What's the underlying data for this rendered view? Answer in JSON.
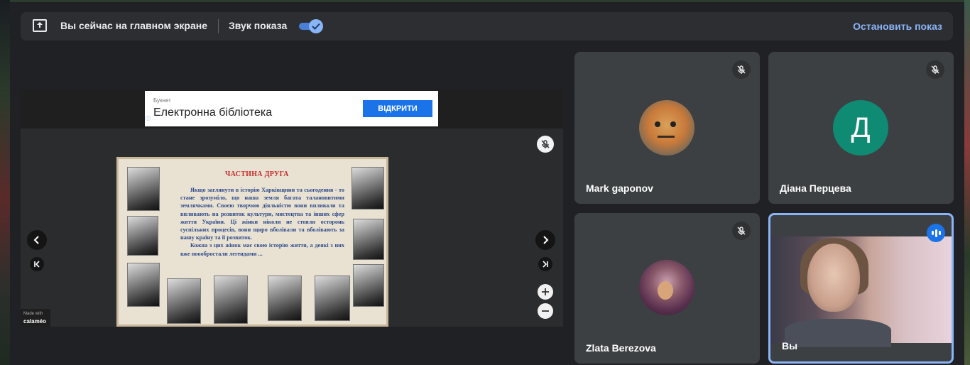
{
  "banner": {
    "status_text": "Вы сейчас на главном экране",
    "sound_label": "Звук показа",
    "sound_enabled": true,
    "stop_label": "Остановить показ"
  },
  "ad": {
    "brand": "Букнет",
    "title": "Електронна бібліотека",
    "button_label": "ВІДКРИТИ",
    "info_icon": "ⓘ"
  },
  "slide": {
    "title": "ЧАСТИНА ДРУГА",
    "paragraphs": [
      "Якщо заглянути в історію Харківщини та сьогодення - то стане зрозуміло, що наша земля багата талановитими землячками. Своєю творчою діяльністю вони впливали та впливають на розвиток культури, мистецтва та інших сфер життя України. Ці жінки ніколи не стояли осторонь суспільних процесів, вони щиро вболівали та вболівають за нашу країну та її розвиток.",
      "Кожна з цих жінок має свою історію життя, а деякі з них вже поообростали легендами ..."
    ]
  },
  "viewer": {
    "made_with": "Made with",
    "made_with_brand": "calaméo"
  },
  "participants": [
    {
      "name": "Mark gaponov",
      "muted": true,
      "avatar_type": "photo"
    },
    {
      "name": "Діана Перцева",
      "muted": true,
      "avatar_type": "letter",
      "avatar_letter": "Д",
      "avatar_color": "#0f8a73"
    },
    {
      "name": "Zlata Berezova",
      "muted": true,
      "avatar_type": "photo"
    },
    {
      "name": "Вы",
      "muted": false,
      "speaking": true,
      "avatar_type": "video"
    }
  ],
  "colors": {
    "accent": "#8ab4f8",
    "background": "#202124",
    "tile": "#3c4043"
  }
}
